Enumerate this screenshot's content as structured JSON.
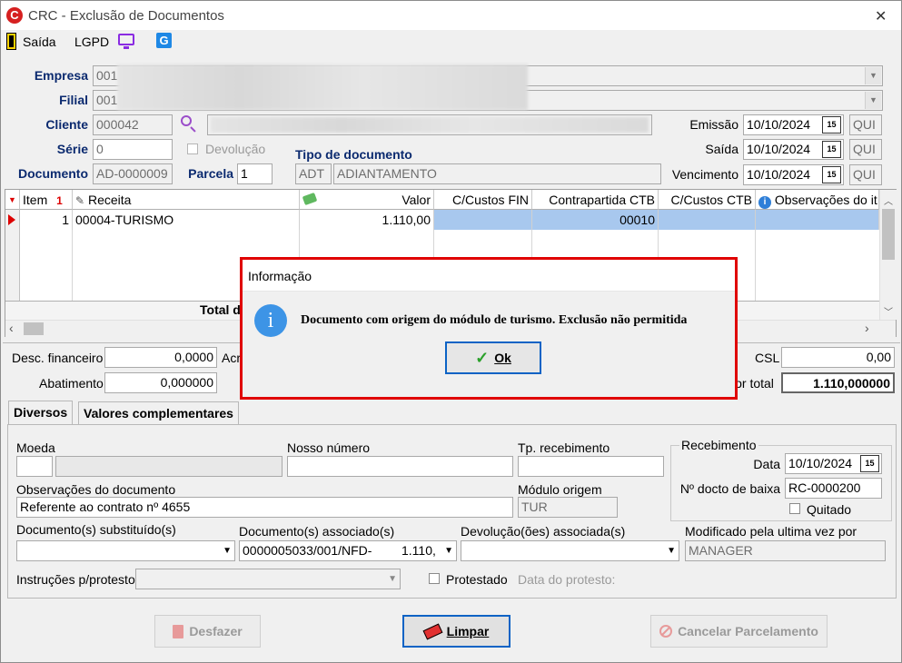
{
  "window": {
    "title": "CRC - Exclusão de Documentos",
    "close_glyph": "✕"
  },
  "toolbar": {
    "saida": "Saída",
    "lgpd": "LGPD"
  },
  "header": {
    "empresa_label": "Empresa",
    "empresa_code": "001",
    "filial_label": "Filial",
    "filial_code": "001",
    "cliente_label": "Cliente",
    "cliente_code": "000042",
    "serie_label": "Série",
    "serie_value": "0",
    "devolucao_label": "Devolução",
    "documento_label": "Documento",
    "documento_value": "AD-0000009",
    "parcela_label": "Parcela",
    "parcela_value": "1",
    "tipo_doc_label": "Tipo de documento",
    "tipo_doc_code": "ADT",
    "tipo_doc_name": "ADIANTAMENTO",
    "emissao_label": "Emissão",
    "emissao_value": "10/10/2024",
    "emissao_day": "QUI",
    "saida_label": "Saída",
    "saida_value": "10/10/2024",
    "saida_day": "QUI",
    "vencimento_label": "Vencimento",
    "vencimento_value": "10/10/2024",
    "vencimento_day": "QUI",
    "cal_glyph": "15"
  },
  "grid": {
    "columns": [
      "Item",
      "Receita",
      "Valor",
      "C/Custos FIN",
      "Contrapartida CTB",
      "C/Custos CTB",
      "Observações do it"
    ],
    "rows": [
      {
        "item": "1",
        "receita": "00004-TURISMO",
        "valor": "1.110,00",
        "ccfin": "",
        "contrapartida": "00010",
        "ccctb": "",
        "obs": ""
      }
    ],
    "total_label": "Total d"
  },
  "totals": {
    "desc_fin_label": "Desc. financeiro",
    "desc_fin_value": "0,0000",
    "acr_label": "Acr",
    "abatimento_label": "Abatimento",
    "abatimento_value": "0,000000",
    "csl_label": "CSL",
    "csl_value": "0,00",
    "valor_total_label": "lor total",
    "valor_total_value": "1.110,000000"
  },
  "tabs": {
    "diversos": "Diversos",
    "valores": "Valores complementares"
  },
  "diversos": {
    "moeda_label": "Moeda",
    "nosso_numero_label": "Nosso número",
    "tp_recebimento_label": "Tp. recebimento",
    "recebimento_group": "Recebimento",
    "data_label": "Data",
    "data_value": "10/10/2024",
    "docto_baixa_label": "Nº docto de baixa",
    "docto_baixa_value": "RC-0000200",
    "quitado_label": "Quitado",
    "obs_label": "Observações do documento",
    "obs_value": "Referente ao contrato nº 4655",
    "modulo_label": "Módulo origem",
    "modulo_value": "TUR",
    "substituido_label": "Documento(s) substituído(s)",
    "associado_label": "Documento(s) associado(s)",
    "associado_value": "0000005033/001/NFD-",
    "associado_amount": "1.110,",
    "devolucao_assoc_label": "Devolução(ões) associada(s)",
    "modificado_label": "Modificado pela ultima vez por",
    "modificado_value": "MANAGER",
    "instrucoes_label": "Instruções p/protesto",
    "protestado_label": "Protestado",
    "data_protesto_label": "Data do protesto:"
  },
  "buttons": {
    "desfazer": "Desfazer",
    "limpar": "Limpar",
    "cancelar": "Cancelar Parcelamento"
  },
  "dialog": {
    "title": "Informação",
    "message": "Documento com origem do módulo de turismo. Exclusão não permitida",
    "ok": "Ok",
    "icon_glyph": "i"
  },
  "colors": {
    "accent_red": "#e00000",
    "label_blue": "#0b2a6f",
    "selection": "#a8c8ee",
    "info_blue": "#3d94e6"
  }
}
